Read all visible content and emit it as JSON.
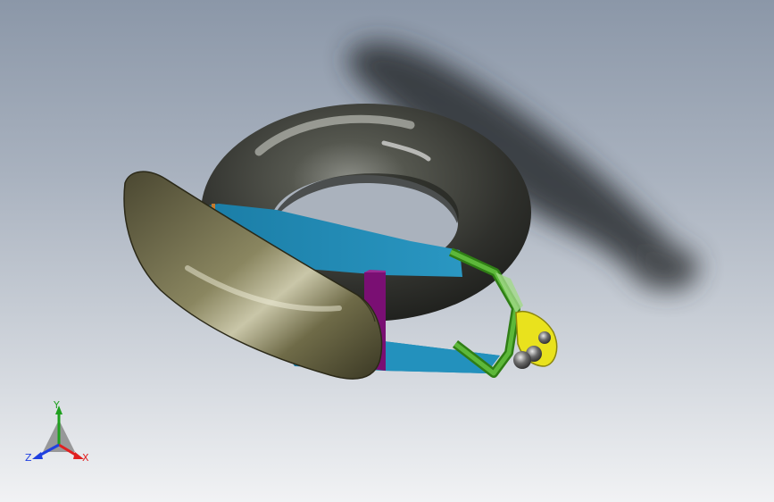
{
  "colors": {
    "background_top": "#8b97a8",
    "background_bottom": "#f1f2f4",
    "tire": "#3b3d38",
    "bumper": "#6e6a45",
    "plate": "#1e86b0",
    "bracket": "#7a0f73",
    "linkage": "#3e9a1e",
    "mount": "#e9e21d",
    "axis_x": "#e02020",
    "axis_y": "#1fa01f",
    "axis_z": "#2040e0"
  },
  "triad": {
    "x_label": "X",
    "y_label": "Y",
    "z_label": "Z"
  },
  "icons": {
    "triad": "orientation-triad-icon"
  }
}
